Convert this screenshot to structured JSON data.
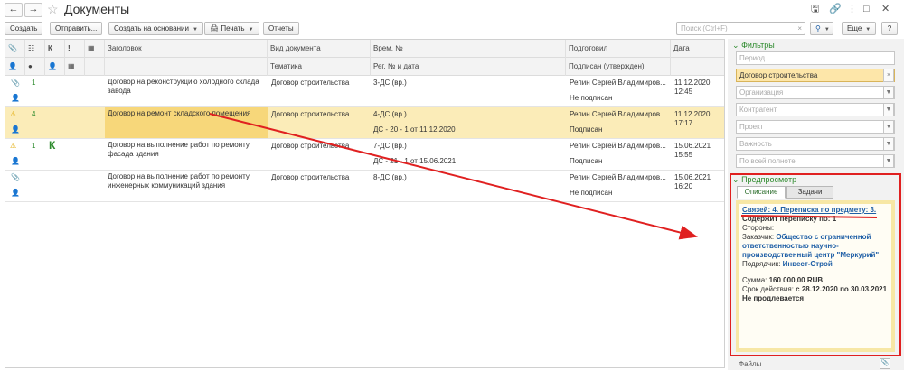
{
  "window": {
    "title": "Документы",
    "icons": [
      "save-icon",
      "link-icon",
      "kebab-icon",
      "restore-icon",
      "close-icon"
    ]
  },
  "toolbar": {
    "create": "Создать",
    "send": "Отправить...",
    "create_based": "Создать на основании",
    "print": "Печать",
    "reports": "Отчеты",
    "search_placeholder": "Поиск (Ctrl+F)",
    "more": "Еще"
  },
  "grid": {
    "headers": {
      "title": "Заголовок",
      "doc_type": "Вид документа",
      "subject": "Тематика",
      "temp_no": "Врем. №",
      "reg_no": "Рег. № и дата",
      "prepared": "Подготовил",
      "signed": "Подписан (утвержден)",
      "date": "Дата",
      "k_col": "К",
      "excl_col": "!"
    },
    "rows": [
      {
        "num": "1",
        "k": "",
        "warn": false,
        "title": "Договор на реконструкцию холодного склада завода",
        "doc_type": "Договор строительства",
        "temp_no": "3-ДС (вр.)",
        "reg_no": "",
        "prepared": "Репин Сергей Владимиров...",
        "signed": "Не подписан",
        "date": "11.12.2020",
        "time": "12:45"
      },
      {
        "num": "4",
        "k": "",
        "warn": true,
        "title": "Договор на ремонт складского помещения",
        "doc_type": "Договор строительства",
        "temp_no": "4-ДС (вр.)",
        "reg_no": "ДС - 20 - 1 от 11.12.2020",
        "prepared": "Репин Сергей Владимиров...",
        "signed": "Подписан",
        "date": "11.12.2020",
        "time": "17:17"
      },
      {
        "num": "1",
        "k": "К",
        "warn": true,
        "title": "Договор  на  выполнение работ по ремонту фасада здания",
        "doc_type": "Договор строительства",
        "temp_no": "7-ДС (вр.)",
        "reg_no": "ДС - 21 - 1 от 15.06.2021",
        "prepared": "Репин Сергей Владимиров...",
        "signed": "Подписан",
        "date": "15.06.2021",
        "time": "15:55"
      },
      {
        "num": "",
        "k": "",
        "warn": false,
        "title": "Договор  на  выполнение работ по ремонту инженерных коммуникаций здания",
        "doc_type": "Договор строительства",
        "temp_no": "8-ДС (вр.)",
        "reg_no": "",
        "prepared": "Репин Сергей Владимиров...",
        "signed": "Не подписан",
        "date": "15.06.2021",
        "time": "16:20"
      }
    ]
  },
  "filters": {
    "title": "Фильтры",
    "fields": [
      "Период...",
      "Договор строительства",
      "Организация",
      "Контрагент",
      "Проект",
      "Важность",
      "По всей полноте"
    ],
    "active_index": 1
  },
  "preview": {
    "title": "Предпросмотр",
    "tabs": [
      "Описание",
      "Задачи"
    ],
    "links_line": "Связей: 4. Переписка по предмету: 3.",
    "correspondence": "Содержит переписку по: 1",
    "parties": "Стороны:",
    "customer_label": "Заказчик:",
    "customer": "Общество с ограниченной ответственностью научно-производственный центр \"Меркурий\"",
    "contractor_label": "Подрядчик:",
    "contractor": "Инвест-Строй",
    "sum_label": "Сумма:",
    "sum": "160 000,00 RUB",
    "term_label": "Срок действия:",
    "term": "с 28.12.2020 по 30.03.2021 Не продлевается",
    "files": "Файлы"
  },
  "colors": {
    "accent_green": "#2e8b2e",
    "selection": "#fbecb8",
    "annotation_red": "#e02020",
    "link_blue": "#1f5fa6"
  }
}
